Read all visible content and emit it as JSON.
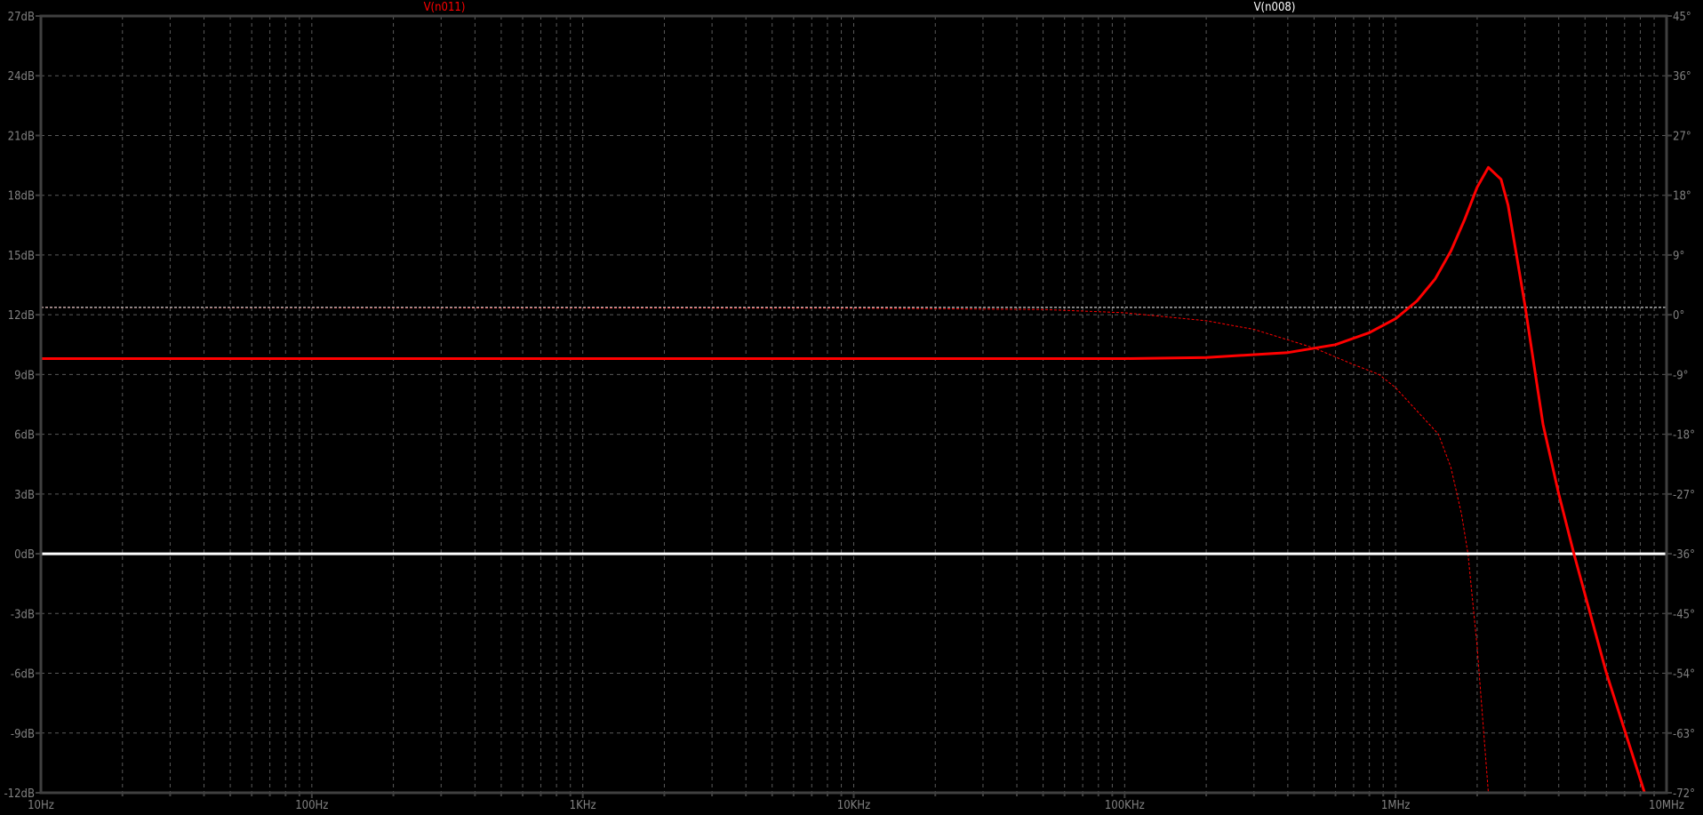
{
  "chart_data": {
    "type": "line",
    "title": "",
    "xscale": "log",
    "xlim": [
      10,
      10000000
    ],
    "x_tick_labels": [
      "10Hz",
      "100Hz",
      "1KHz",
      "10KHz",
      "100KHz",
      "1MHz",
      "10MHz"
    ],
    "x_tick_values": [
      10,
      100,
      1000,
      10000,
      100000,
      1000000,
      10000000
    ],
    "ylim": [
      -12,
      27
    ],
    "y_ticks": [
      -12,
      -9,
      -6,
      -3,
      0,
      3,
      6,
      9,
      12,
      15,
      18,
      21,
      24,
      27
    ],
    "y_tick_labels": [
      "-12dB",
      "-9dB",
      "-6dB",
      "-3dB",
      "0dB",
      "3dB",
      "6dB",
      "9dB",
      "12dB",
      "15dB",
      "18dB",
      "21dB",
      "24dB",
      "27dB"
    ],
    "y2lim": [
      -72,
      45
    ],
    "y2_ticks": [
      -72,
      -63,
      -54,
      -45,
      -36,
      -27,
      -18,
      -9,
      0,
      9,
      18,
      27,
      36,
      45
    ],
    "y2_tick_labels": [
      "-72°",
      "-63°",
      "-54°",
      "-45°",
      "-36°",
      "-27°",
      "-18°",
      "-9°",
      "0°",
      "9°",
      "18°",
      "27°",
      "36°",
      "45°"
    ],
    "grid": true,
    "series": [
      {
        "name": "V(n011)",
        "color": "#ff0000",
        "magnitude_db": [
          [
            10,
            9.8
          ],
          [
            100000,
            9.8
          ],
          [
            200000,
            9.85
          ],
          [
            400000,
            10.1
          ],
          [
            600000,
            10.5
          ],
          [
            800000,
            11.1
          ],
          [
            1000000,
            11.8
          ],
          [
            1200000,
            12.7
          ],
          [
            1400000,
            13.8
          ],
          [
            1600000,
            15.2
          ],
          [
            1800000,
            16.8
          ],
          [
            2000000,
            18.4
          ],
          [
            2200000,
            19.4
          ],
          [
            2450000,
            18.8
          ],
          [
            2600000,
            17.5
          ],
          [
            3000000,
            12.5
          ],
          [
            3500000,
            6.5
          ],
          [
            4000000,
            3
          ],
          [
            4550000,
            0
          ],
          [
            6000000,
            -6
          ],
          [
            8300000,
            -12
          ]
        ],
        "phase_deg": [
          [
            10,
            1.1
          ],
          [
            10000,
            1.0
          ],
          [
            50000,
            0.8
          ],
          [
            100000,
            0.3
          ],
          [
            200000,
            -0.9
          ],
          [
            300000,
            -2.2
          ],
          [
            500000,
            -5
          ],
          [
            700000,
            -7.5
          ],
          [
            870000,
            -9
          ],
          [
            1000000,
            -11
          ],
          [
            1200000,
            -14.5
          ],
          [
            1440000,
            -18
          ],
          [
            1600000,
            -23
          ],
          [
            1750000,
            -30
          ],
          [
            1850000,
            -36
          ],
          [
            2000000,
            -50
          ],
          [
            2200000,
            -72
          ]
        ]
      },
      {
        "name": "V(n008)",
        "color": "#ffffff",
        "magnitude_db": [
          [
            10,
            0
          ],
          [
            10000000,
            0
          ]
        ],
        "phase_deg": [
          [
            10,
            1.1
          ],
          [
            10000000,
            1.1
          ]
        ]
      }
    ]
  }
}
